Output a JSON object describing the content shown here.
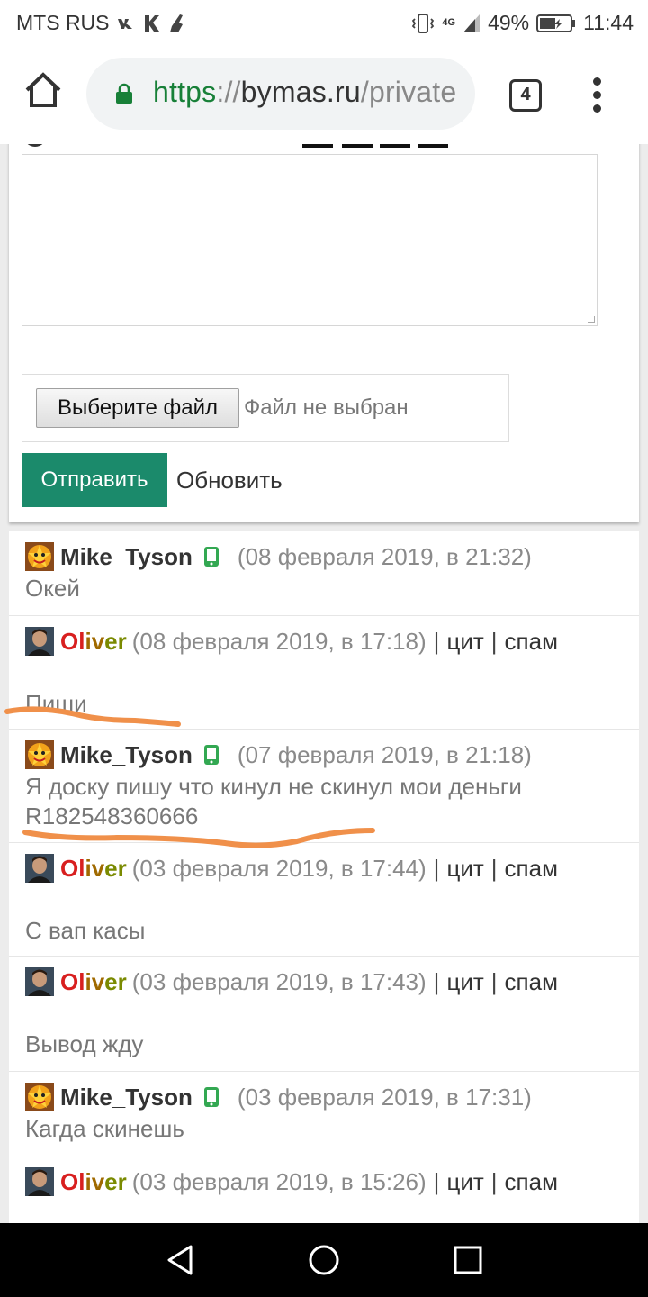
{
  "status_bar": {
    "carrier": "MTS RUS",
    "network": "4G",
    "battery": "49%",
    "time": "11:44",
    "icons": [
      "vk-icon",
      "kaspersky-icon",
      "cleaner-icon",
      "vibrate-icon",
      "signal-icon",
      "battery-icon"
    ]
  },
  "browser": {
    "url_scheme": "https",
    "url_sep": "://",
    "url_host": "bymas.ru",
    "url_path": "/private",
    "tab_count": "4"
  },
  "form": {
    "file_button_label": "Выберите файл",
    "file_status": "Файл не выбран",
    "submit_label": "Отправить",
    "refresh_label": "Обновить"
  },
  "actions": {
    "quote": "цит",
    "spam": "спам",
    "separator": "|"
  },
  "messages": [
    {
      "author": "Mike_Tyson",
      "date": "(08 февраля 2019, в 21:32)",
      "text": "Окей"
    },
    {
      "author": "Oliver",
      "date": "(08 февраля 2019, в 17:18)",
      "text": "Пиши"
    },
    {
      "author": "Mike_Tyson",
      "date": "(07 февраля 2019, в 21:18)",
      "text": "Я доску пишу что кинул не скинул мои деньги",
      "text2": "R182548360666"
    },
    {
      "author": "Oliver",
      "date": "(03 февраля 2019, в 17:44)",
      "text": "С вап касы"
    },
    {
      "author": "Oliver",
      "date": "(03 февраля 2019, в 17:43)",
      "text": "Вывод жду"
    },
    {
      "author": "Mike_Tyson",
      "date": "(03 февраля 2019, в 17:31)",
      "text": "Кагда скинешь"
    },
    {
      "author": "Oliver",
      "date": "(03 февраля 2019, в 15:26)",
      "text": ""
    }
  ],
  "colors": {
    "accent_button": "#1b8a6b",
    "secure_green": "#188038",
    "annotation_orange": "#f0904a",
    "oliver_gradient": [
      "#d81f1f",
      "#a06a00",
      "#7a8a00"
    ]
  }
}
